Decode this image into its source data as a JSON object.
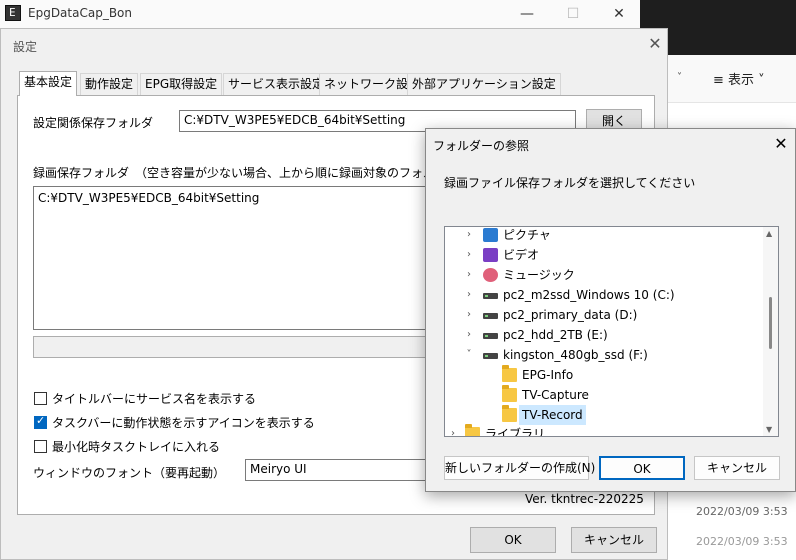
{
  "main_window": {
    "title": "EpgDataCap_Bon",
    "minimize": "—",
    "maximize": "☐",
    "close": "✕"
  },
  "explorer": {
    "view_label": "≡  表示  ˅",
    "chevron": "˅",
    "date1": "2022/03/09 3:53",
    "date2": "2022/03/09 3:53"
  },
  "settings": {
    "title": "設定",
    "close": "✕",
    "tabs": [
      "基本設定",
      "動作設定",
      "EPG取得設定",
      "サービス表示設定",
      "ネットワーク設定",
      "外部アプリケーション設定"
    ],
    "setting_folder_label": "設定関係保存フォルダ",
    "setting_folder_value": "C:¥DTV_W3PE5¥EDCB_64bit¥Setting",
    "open_button": "開く",
    "rec_folder_label": "録画保存フォルダ　（空き容量が少ない場合、上から順に録画対象のフォルダとしま",
    "rec_folder_items": [
      "C:¥DTV_W3PE5¥EDCB_64bit¥Setting"
    ],
    "checkbox_titlebar": "タイトルバーにサービス名を表示する",
    "checkbox_taskbar": "タスクバーに動作状態を示すアイコンを表示する",
    "checkbox_tray": "最小化時タスクトレイに入れる",
    "checkbox_titlebar_checked": false,
    "checkbox_taskbar_checked": true,
    "checkbox_tray_checked": false,
    "font_label": "ウィンドウのフォント（要再起動）",
    "font_value": "Meiryo UI",
    "version": "Ver. tkntrec-220225",
    "ok_button": "OK",
    "cancel_button": "キャンセル"
  },
  "folder_dialog": {
    "title": "フォルダーの参照",
    "close": "✕",
    "instruction": "録画ファイル保存フォルダを選択してください",
    "tree": [
      {
        "label": "ピクチャ",
        "icon": "pictures-icon",
        "expander": "›",
        "selected": false
      },
      {
        "label": "ビデオ",
        "icon": "videos-icon",
        "expander": "›",
        "selected": false
      },
      {
        "label": "ミュージック",
        "icon": "music-icon",
        "expander": "›",
        "selected": false
      },
      {
        "label": "pc2_m2ssd_Windows 10 (C:)",
        "icon": "windows-drive-icon",
        "expander": "›",
        "selected": false
      },
      {
        "label": "pc2_primary_data (D:)",
        "icon": "drive-icon",
        "expander": "›",
        "selected": false
      },
      {
        "label": "pc2_hdd_2TB (E:)",
        "icon": "drive-icon",
        "expander": "›",
        "selected": false
      },
      {
        "label": "kingston_480gb_ssd (F:)",
        "icon": "network-drive-icon",
        "expander": "˅",
        "selected": false
      },
      {
        "label": "EPG-Info",
        "icon": "folder-icon",
        "expander": "",
        "selected": false
      },
      {
        "label": "TV-Capture",
        "icon": "folder-icon",
        "expander": "",
        "selected": false
      },
      {
        "label": "TV-Record",
        "icon": "folder-icon",
        "expander": "",
        "selected": true
      },
      {
        "label": "ライブラリ",
        "icon": "folder-icon",
        "expander": "›",
        "selected": false
      }
    ],
    "new_folder_button": "新しいフォルダーの作成(N)",
    "ok_button": "OK",
    "cancel_button": "キャンセル"
  }
}
